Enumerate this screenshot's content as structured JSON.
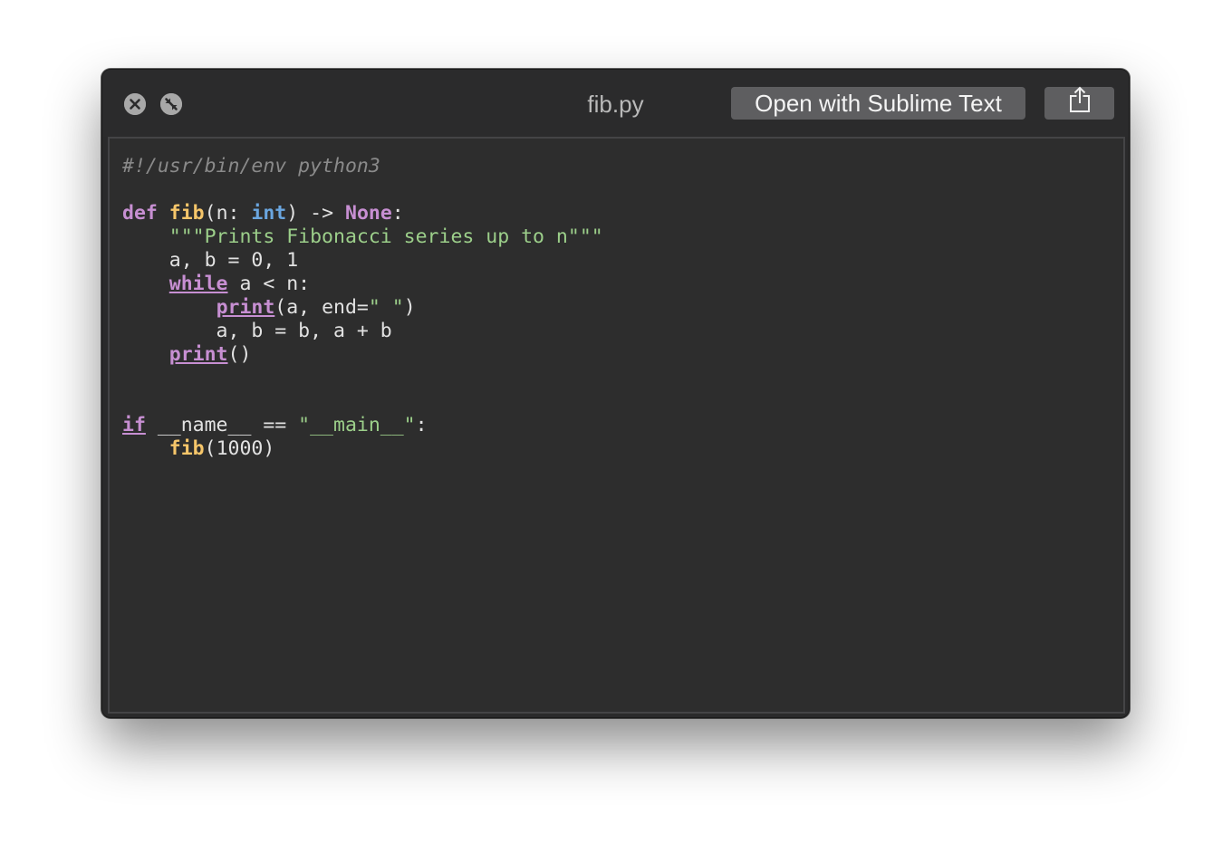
{
  "window": {
    "title": "fib.py",
    "open_button_label": "Open with Sublime Text"
  },
  "icons": {
    "close": "close-icon",
    "minimize": "fullscreen-off-icon",
    "share": "share-icon"
  },
  "colors": {
    "keyword": "#c78fd2",
    "function": "#f6c66a",
    "type": "#6aa6e0",
    "string": "#9ccf8a",
    "comment": "#8a8a8a",
    "text": "#e2e2e2",
    "background": "#2d2d2d"
  },
  "code": {
    "lines": [
      [
        {
          "t": "comment",
          "v": "#!/usr/bin/env python3"
        }
      ],
      [],
      [
        {
          "t": "keyword",
          "v": "def"
        },
        {
          "t": "plain",
          "v": " "
        },
        {
          "t": "func",
          "v": "fib"
        },
        {
          "t": "plain",
          "v": "(n: "
        },
        {
          "t": "type",
          "v": "int"
        },
        {
          "t": "plain",
          "v": ") -> "
        },
        {
          "t": "keyword",
          "v": "None"
        },
        {
          "t": "plain",
          "v": ":"
        }
      ],
      [
        {
          "t": "plain",
          "v": "    "
        },
        {
          "t": "string",
          "v": "\"\"\"Prints Fibonacci series up to n\"\"\""
        }
      ],
      [
        {
          "t": "plain",
          "v": "    a, b = 0, 1"
        }
      ],
      [
        {
          "t": "plain",
          "v": "    "
        },
        {
          "t": "builtin-kw",
          "v": "while"
        },
        {
          "t": "plain",
          "v": " a < n:"
        }
      ],
      [
        {
          "t": "plain",
          "v": "        "
        },
        {
          "t": "builtin-kw",
          "v": "print"
        },
        {
          "t": "plain",
          "v": "(a, end="
        },
        {
          "t": "string",
          "v": "\" \""
        },
        {
          "t": "plain",
          "v": ")"
        }
      ],
      [
        {
          "t": "plain",
          "v": "        a, b = b, a + b"
        }
      ],
      [
        {
          "t": "plain",
          "v": "    "
        },
        {
          "t": "builtin-kw",
          "v": "print"
        },
        {
          "t": "plain",
          "v": "()"
        }
      ],
      [],
      [],
      [
        {
          "t": "builtin-kw",
          "v": "if"
        },
        {
          "t": "plain",
          "v": " __name__ == "
        },
        {
          "t": "string",
          "v": "\"__main__\""
        },
        {
          "t": "plain",
          "v": ":"
        }
      ],
      [
        {
          "t": "plain",
          "v": "    "
        },
        {
          "t": "func",
          "v": "fib"
        },
        {
          "t": "plain",
          "v": "(1000)"
        }
      ]
    ]
  }
}
